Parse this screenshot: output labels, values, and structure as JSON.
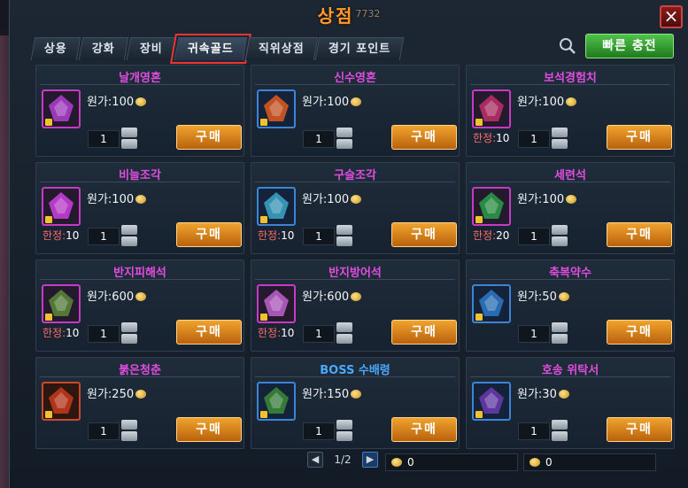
{
  "window": {
    "title": "상점",
    "title_number": "7732"
  },
  "tabs": [
    {
      "label": "상용"
    },
    {
      "label": "강화"
    },
    {
      "label": "장비"
    },
    {
      "label": "귀속골드",
      "active": true
    },
    {
      "label": "직위상점"
    },
    {
      "label": "경기 포인트"
    }
  ],
  "header": {
    "recharge_label": "빠른 충전"
  },
  "buy_label": "구매",
  "limit_label": "한정:",
  "items": [
    {
      "name": "날개영혼",
      "price": "원가:100",
      "qty": "1",
      "limit": "",
      "icon": "wing-soul-icon",
      "name_color": "purple"
    },
    {
      "name": "신수영혼",
      "price": "원가:100",
      "qty": "1",
      "limit": "",
      "icon": "beast-soul-icon",
      "name_color": "purple"
    },
    {
      "name": "보석경험치",
      "price": "원가:100",
      "qty": "1",
      "limit": "10",
      "icon": "gem-exp-icon",
      "name_color": "purple"
    },
    {
      "name": "비늘조각",
      "price": "원가:100",
      "qty": "1",
      "limit": "10",
      "icon": "scale-fragment-icon",
      "name_color": "purple"
    },
    {
      "name": "구슬조각",
      "price": "원가:100",
      "qty": "1",
      "limit": "10",
      "icon": "orb-fragment-icon",
      "name_color": "purple"
    },
    {
      "name": "세련석",
      "price": "원가:100",
      "qty": "1",
      "limit": "20",
      "icon": "refine-stone-icon",
      "name_color": "purple"
    },
    {
      "name": "반지피해석",
      "price": "원가:600",
      "qty": "1",
      "limit": "10",
      "icon": "ring-damage-stone-icon",
      "name_color": "purple"
    },
    {
      "name": "반지방어석",
      "price": "원가:600",
      "qty": "1",
      "limit": "10",
      "icon": "ring-defense-stone-icon",
      "name_color": "purple"
    },
    {
      "name": "축복약수",
      "price": "원가:50",
      "qty": "1",
      "limit": "",
      "icon": "blessing-potion-icon",
      "name_color": "purple"
    },
    {
      "name": "붉은청춘",
      "price": "원가:250",
      "qty": "1",
      "limit": "",
      "icon": "red-youth-icon",
      "name_color": "purple"
    },
    {
      "name": "BOSS 수배령",
      "price": "원가:150",
      "qty": "1",
      "limit": "",
      "icon": "boss-bounty-icon",
      "name_color": "blue"
    },
    {
      "name": "호송 위탁서",
      "price": "원가:30",
      "qty": "1",
      "limit": "",
      "icon": "escort-contract-icon",
      "name_color": "purple"
    }
  ],
  "pager": {
    "text": "1/2"
  },
  "currency": [
    {
      "value": "0"
    },
    {
      "value": "0"
    }
  ],
  "colors": {
    "accent_orange": "#ff9a32",
    "name_purple": "#e04de0",
    "name_blue": "#4aa8ff",
    "buy_button": "#f0a32e",
    "recharge_button": "#4fc24a"
  }
}
